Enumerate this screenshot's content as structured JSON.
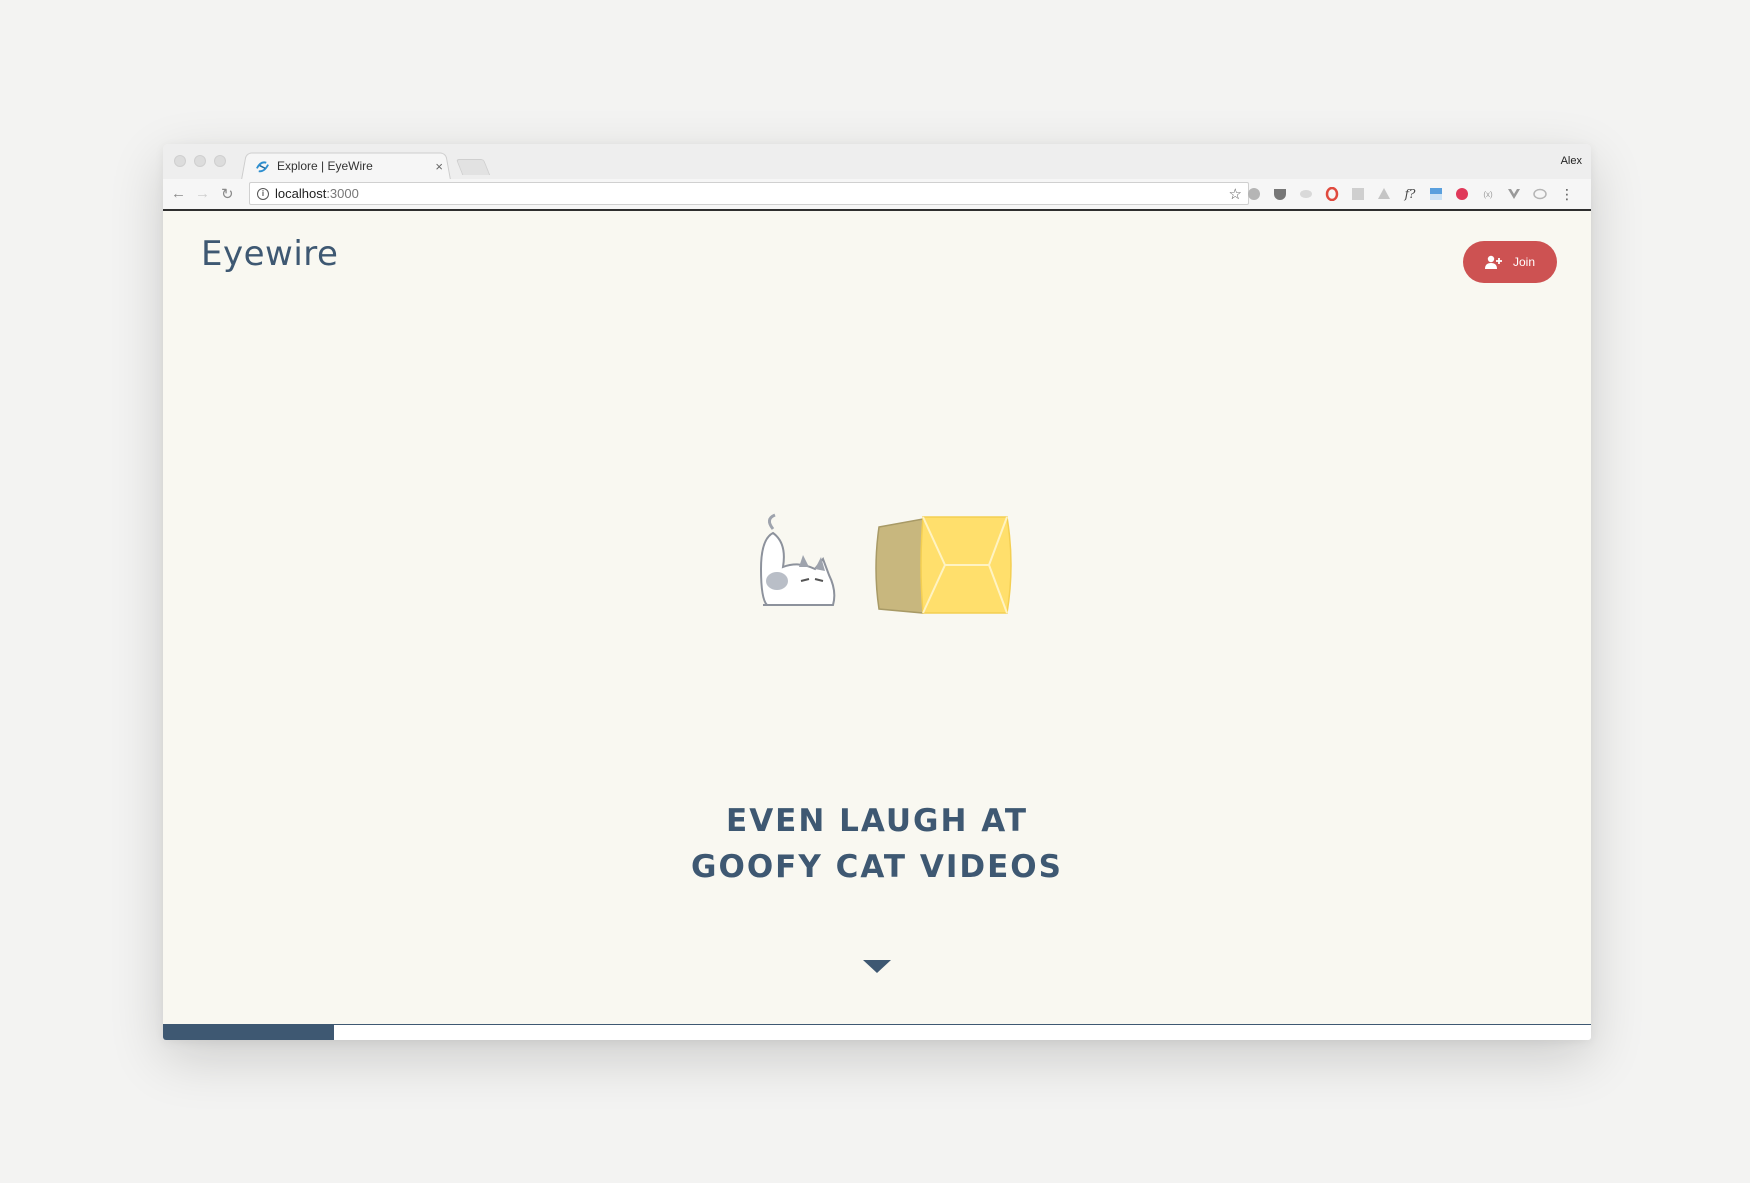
{
  "browser": {
    "tab_title": "Explore | EyeWire",
    "tab_close": "×",
    "profile_name": "Alex",
    "url_host": "localhost",
    "url_port": ":3000",
    "nav": {
      "back": "←",
      "forward": "→",
      "reload": "↻"
    },
    "bookmark_star": "☆",
    "extensions": [
      "adblock-icon",
      "pocket-icon",
      "grey-leaf-icon",
      "opera-icon",
      "g-icon",
      "drive-icon",
      "formula-icon",
      "image-icon",
      "pinterest-icon",
      "brackets-icon",
      "vue-icon",
      "chat-icon"
    ],
    "formula_ext_label": "f?",
    "menu": "⋮"
  },
  "page": {
    "logo": "Eyewire",
    "join_label": "Join",
    "headline_line1": "EVEN LAUGH AT",
    "headline_line2": "GOOFY CAT VIDEOS",
    "progress": 0.12
  },
  "colors": {
    "navy": "#3e5872",
    "join_red": "#cd5252",
    "page_bg": "#f9f8f1",
    "box_yellow": "#ffdf6c",
    "box_side": "#c8b77e"
  }
}
